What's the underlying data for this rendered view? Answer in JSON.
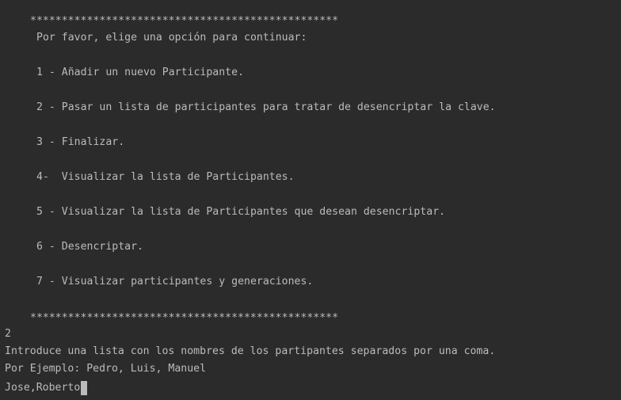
{
  "console": {
    "stars_top": "*************************************************",
    "prompt": "Por favor, elige una opción para continuar:",
    "options": [
      "1 - Añadir un nuevo Participante.",
      "2 - Pasar un lista de participantes para tratar de desencriptar la clave.",
      "3 - Finalizar.",
      "4-  Visualizar la lista de Participantes.",
      "5 - Visualizar la lista de Participantes que desean desencriptar.",
      "6 - Desencriptar.",
      "7 - Visualizar participantes y generaciones."
    ],
    "stars_bottom": "*************************************************",
    "user_choice": "2",
    "instruction": "Introduce una lista con los nombres de los partipantes separados por una coma.",
    "example": "Por Ejemplo: Pedro, Luis, Manuel",
    "current_input": "Jose,Roberto"
  }
}
